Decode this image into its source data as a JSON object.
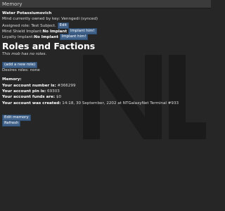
{
  "window": {
    "title": "Memory"
  },
  "mob_name": "Water Potassiumovich",
  "mind_owner": "Mind currently owned by key: Venngedi (synced)",
  "assigned_role": {
    "label": "Assigned role: Test Subject.",
    "edit_button": "Edit"
  },
  "mind_shield": {
    "label": "Mind Shield Implant:",
    "value": "No Implant",
    "button": "Implant him!"
  },
  "loyalty": {
    "label": "Loyalty Implant:",
    "value": "No Implant",
    "button": "Implant him!"
  },
  "roles_heading": "Roles and Factions",
  "no_roles_text": "This mob has no roles.",
  "add_role_button": "(add a new role)",
  "desires_roles": "Desires roles: none",
  "memory": {
    "heading": "Memory:",
    "account_number_label": "Your account number is:",
    "account_number": "#366299",
    "account_pin_label": "Your account pin is:",
    "account_pin": "69303",
    "account_funds_label": "Your account funds are:",
    "account_funds": "$0",
    "account_created_label": "Your account was created:",
    "account_created": "14:18, 30 September, 2202 at NTGalaxyNet Terminal #933"
  },
  "edit_memory_button": "Edit memory",
  "refresh_button": "Refresh",
  "logo_icon": "nt-logo-icon"
}
